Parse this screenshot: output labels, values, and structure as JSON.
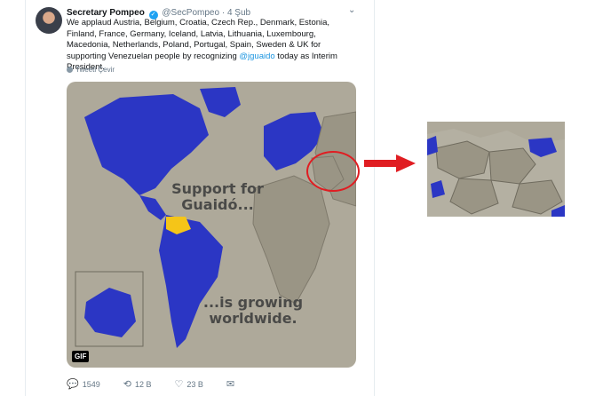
{
  "tweet": {
    "author_name": "Secretary Pompeo",
    "handle": "@SecPompeo",
    "separator": "·",
    "date": "4 Şub",
    "text_part1": "We applaud Austria, Belgium, Croatia, Czech Rep., Denmark, Estonia, Finland, France, Germany, Iceland, Latvia, Lithuania, Luxembourg, Macedonia, Netherlands, Poland, Portugal, Spain, Sweden & UK for supporting Venezuelan people by recognizing ",
    "mention": "@jguaido",
    "text_part2": " today as Interim President.",
    "translate_label": "Tweeti Çevir",
    "menu_icon": "chevron-down-icon"
  },
  "media": {
    "headline_1": "Support for Guaidó...",
    "headline_2": "...is growing worldwide.",
    "gif_label": "GIF",
    "colors": {
      "ocean": "#aea99a",
      "supporters": "#2b36c4",
      "venezuela": "#f5c518",
      "land": "#cfcbbd"
    }
  },
  "actions": {
    "reply_count": "1549",
    "retweet_count": "12 B",
    "like_count": "23 B"
  },
  "annotation": {
    "color": "#e01d22"
  }
}
